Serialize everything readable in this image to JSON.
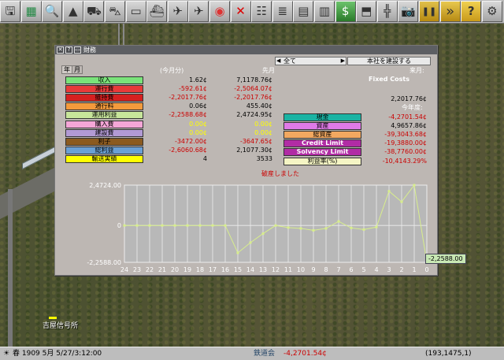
{
  "toolbar": {
    "buttons": [
      {
        "icon": "game-menu-icon",
        "glyph": "🖫"
      },
      {
        "icon": "map-icon",
        "glyph": "▦"
      },
      {
        "icon": "magnifier-icon",
        "glyph": "🔍"
      },
      {
        "icon": "terrain-icon",
        "glyph": "▲"
      },
      {
        "icon": "rail-build-icon",
        "glyph": "⛟"
      },
      {
        "icon": "road-build-icon",
        "glyph": "⛍"
      },
      {
        "icon": "tram-build-icon",
        "glyph": "▭"
      },
      {
        "icon": "ship-build-icon",
        "glyph": "⛴"
      },
      {
        "icon": "airport-build-icon",
        "glyph": "✈"
      },
      {
        "icon": "airplane-icon",
        "glyph": "✈"
      },
      {
        "icon": "target-icon",
        "glyph": "◉"
      },
      {
        "icon": "demolish-icon",
        "glyph": "✕"
      },
      {
        "icon": "info-stack-icon",
        "glyph": "☷"
      },
      {
        "icon": "list-icon",
        "glyph": "≣"
      },
      {
        "icon": "document-icon",
        "glyph": "▤"
      },
      {
        "icon": "document-icon-2",
        "glyph": "▥"
      },
      {
        "icon": "money-icon",
        "glyph": "$"
      },
      {
        "icon": "graph-icon",
        "glyph": "⬒"
      },
      {
        "icon": "railway-icon",
        "glyph": "╬"
      },
      {
        "icon": "camera-icon",
        "glyph": "📷"
      },
      {
        "icon": "pause-icon",
        "glyph": "❚❚"
      },
      {
        "icon": "fast-forward-icon",
        "glyph": "»"
      },
      {
        "icon": "help-icon",
        "glyph": "?"
      },
      {
        "icon": "settings-icon",
        "glyph": "⚙"
      }
    ]
  },
  "window": {
    "title": "財務",
    "tab_year": "年",
    "tab_month": "月",
    "header_current": "今月分",
    "header_prev": "先月",
    "dropdown_value": "全て",
    "build_hq_label": "本社を建設する",
    "header_next_month": "来月:",
    "fixed_costs_label": "Fixed Costs",
    "fixed_costs_value": "2,2017.76¢",
    "this_year_label": "今年度:",
    "bankrupt_text": "破産しました",
    "rows": [
      {
        "label": "収入",
        "color": "#7ae37a",
        "cur": "1.62¢",
        "prev": "7,1178.76¢",
        "cur_color": "#000",
        "prev_color": "#000"
      },
      {
        "label": "運行費",
        "color": "#e83a3a",
        "cur": "-592.61¢",
        "prev": "-2,5064.07¢",
        "cur_color": "#c00",
        "prev_color": "#c00"
      },
      {
        "label": "維持費",
        "color": "#d62020",
        "cur": "-2,2017.76¢",
        "prev": "-2,2017.76¢",
        "cur_color": "#c00",
        "prev_color": "#c00"
      },
      {
        "label": "通行料",
        "color": "#f39a3c",
        "cur": "0.06¢",
        "prev": "455.40¢",
        "cur_color": "#000",
        "prev_color": "#000"
      },
      {
        "label": "運用利益",
        "color": "#c7e59a",
        "cur": "-2,2588.68¢",
        "prev": "2,4724.95¢",
        "cur_color": "#c00",
        "prev_color": "#000"
      },
      {
        "label": "購入費",
        "color": "#f5a6d7",
        "cur": "0.00¢",
        "prev": "0.00¢",
        "cur_color": "#ff0",
        "prev_color": "#ff0"
      },
      {
        "label": "建設費",
        "color": "#b29ad4",
        "cur": "0.00¢",
        "prev": "0.00¢",
        "cur_color": "#ff0",
        "prev_color": "#ff0"
      },
      {
        "label": "利子",
        "color": "#8b5a1f",
        "cur": "-3472.00¢",
        "prev": "-3647.65¢",
        "cur_color": "#c00",
        "prev_color": "#c00"
      },
      {
        "label": "総利益",
        "color": "#6aa0d6",
        "cur": "-2,6060.68¢",
        "prev": "2,1077.30¢",
        "cur_color": "#c00",
        "prev_color": "#000"
      },
      {
        "label": "輸送実績",
        "color": "#ffff00",
        "cur": "4",
        "prev": "3533",
        "cur_color": "#000",
        "prev_color": "#000"
      }
    ],
    "right_rows": [
      {
        "label": "現金",
        "color": "#1ab3a3",
        "value": "-4,2701.54¢",
        "value_color": "#c00"
      },
      {
        "label": "資産",
        "color": "#e07ae8",
        "value": "4,9657.86¢",
        "value_color": "#000"
      },
      {
        "label": "総資産",
        "color": "#f2a860",
        "value": "-39,3043.68¢",
        "value_color": "#c00"
      },
      {
        "label": "Credit Limit",
        "color": "#b12ca5",
        "value": "-19,3880.00¢",
        "value_color": "#c00"
      },
      {
        "label": "Solvency Limit",
        "color": "#b12ca5",
        "value": "-38,7760.00¢",
        "value_color": "#c00"
      },
      {
        "label": "利益率(%)",
        "color": "#f5f5c4",
        "value": "-10,4143.29%",
        "value_color": "#c00"
      }
    ]
  },
  "chart_data": {
    "type": "line",
    "title": "",
    "xlabel": "",
    "ylabel": "",
    "x": [
      24,
      23,
      22,
      21,
      20,
      19,
      18,
      17,
      16,
      15,
      14,
      13,
      12,
      11,
      10,
      9,
      8,
      7,
      6,
      5,
      4,
      3,
      2,
      1,
      0
    ],
    "x_labels": [
      "24",
      "23",
      "22",
      "21",
      "20",
      "19",
      "18",
      "17",
      "16",
      "15",
      "14",
      "13",
      "12",
      "11",
      "10",
      "9",
      "8",
      "7",
      "6",
      "5",
      "4",
      "3",
      "2",
      "1",
      "0"
    ],
    "y_tick_labels": [
      "2,4724.00",
      "0",
      "-2,2588.00"
    ],
    "ylim": [
      -22588,
      24724
    ],
    "series": [
      {
        "color": "#d8ee8c",
        "values": [
          0,
          0,
          0,
          0,
          0,
          0,
          0,
          0,
          0,
          -16800,
          -10500,
          -5000,
          0,
          -1300,
          -1800,
          -3000,
          -1800,
          2500,
          -1500,
          -2500,
          -1000,
          21000,
          14500,
          24724,
          -22588
        ]
      }
    ],
    "grid": true,
    "tooltip": "-2,2588.00"
  },
  "map": {
    "sign_text": "吉屋信号所"
  },
  "status": {
    "date": "春 1909 5月 5/27/3:12:00",
    "company": "鉄道会",
    "cash": "-4,2701.54¢",
    "coords": "(193,1475,1)"
  }
}
